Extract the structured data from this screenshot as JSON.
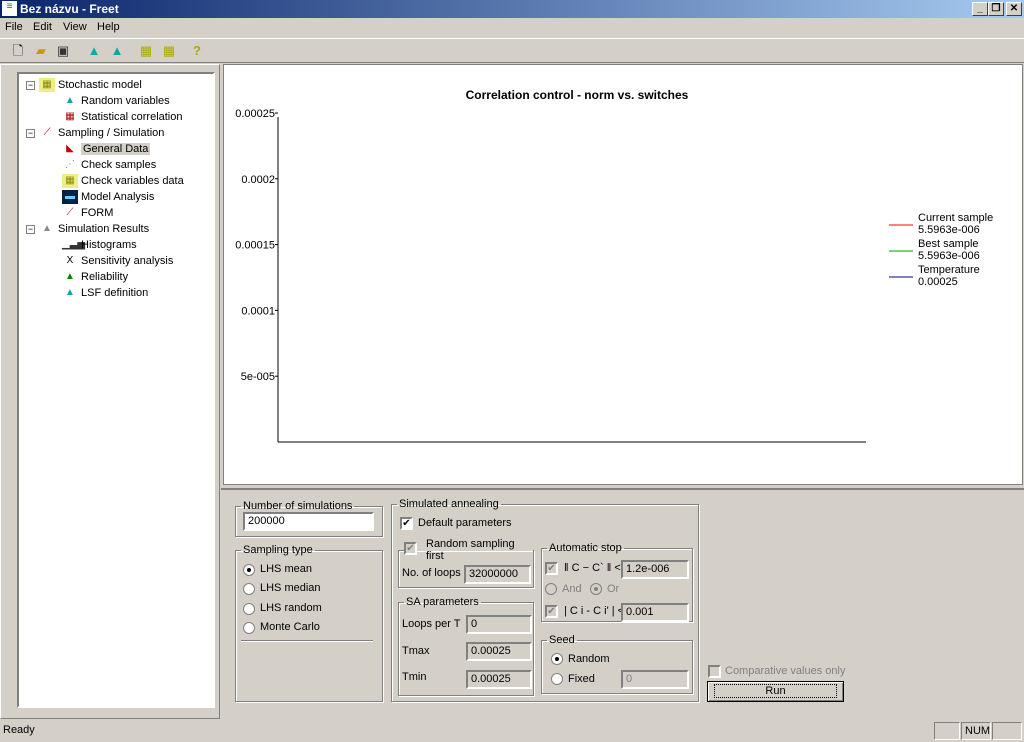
{
  "window": {
    "title": "Bez názvu - Freet",
    "min": "_",
    "restore": "❐",
    "close": "✕"
  },
  "menu": [
    "File",
    "Edit",
    "View",
    "Help"
  ],
  "toolbar": {
    "icons": [
      "new-file-icon",
      "open-folder-icon",
      "save-icon",
      "add-variable-icon",
      "edit-variable-icon",
      "add-data-icon",
      "edit-data-icon",
      "help-icon"
    ]
  },
  "tree": {
    "groups": [
      {
        "label": "Stochastic model",
        "items": [
          "Random variables",
          "Statistical correlation"
        ]
      },
      {
        "label": "Sampling / Simulation",
        "items": [
          "General Data",
          "Check samples",
          "Check variables data",
          "Model Analysis",
          "FORM"
        ]
      },
      {
        "label": "Simulation Results",
        "items": [
          "Histograms",
          "Sensitivity analysis",
          "Reliability",
          "LSF definition"
        ]
      }
    ],
    "selected": "General Data"
  },
  "chart_data": {
    "type": "line",
    "title": "Correlation control - norm vs. switches",
    "xlabel": "",
    "ylabel": "",
    "ylim": [
      0,
      0.00025
    ],
    "yticks": [
      "0.00025",
      "0.0002",
      "0.00015",
      "0.0001",
      "5e-005"
    ],
    "ytick_values": [
      0.00025,
      0.0002,
      0.00015,
      0.0001,
      5e-05
    ],
    "legend_position": "right",
    "series": [
      {
        "name": "Current sample",
        "value_label": "5.5963e-006",
        "color": "#ff0000",
        "values": []
      },
      {
        "name": "Best sample",
        "value_label": "5.5963e-006",
        "color": "#00a000",
        "values": []
      },
      {
        "name": "Temperature",
        "value_label": "0.00025",
        "color": "#000080",
        "values": []
      }
    ]
  },
  "form": {
    "num_sim": {
      "legend": "Number of simulations",
      "value": "200000"
    },
    "sampling": {
      "legend": "Sampling type",
      "options": [
        "LHS mean",
        "LHS median",
        "LHS random",
        "Monte Carlo"
      ],
      "selected": "LHS mean"
    },
    "sa": {
      "legend": "Simulated annealing",
      "default_params": "Default parameters",
      "random_first": "Random sampling first",
      "loops_label": "No. of loops",
      "loops": "32000000",
      "params_legend": "SA parameters",
      "loops_per_t_label": "Loops per T",
      "loops_per_t": "0",
      "tmax_label": "Tmax",
      "tmax": "0.00025",
      "tmin_label": "Tmin",
      "tmin": "0.00025",
      "auto_stop": "Automatic stop",
      "norm_label": "ǁ C − C` ǁ <",
      "norm": "1.2e-006",
      "and": "And",
      "or": "Or",
      "elem_label": "| C i - C i' | <",
      "elem": "0.001",
      "seed": "Seed",
      "random": "Random",
      "fixed": "Fixed",
      "fixed_value": "0"
    },
    "comparative": "Comparative values only",
    "run": "Run"
  },
  "status": {
    "text": "Ready",
    "num": "NUM"
  }
}
